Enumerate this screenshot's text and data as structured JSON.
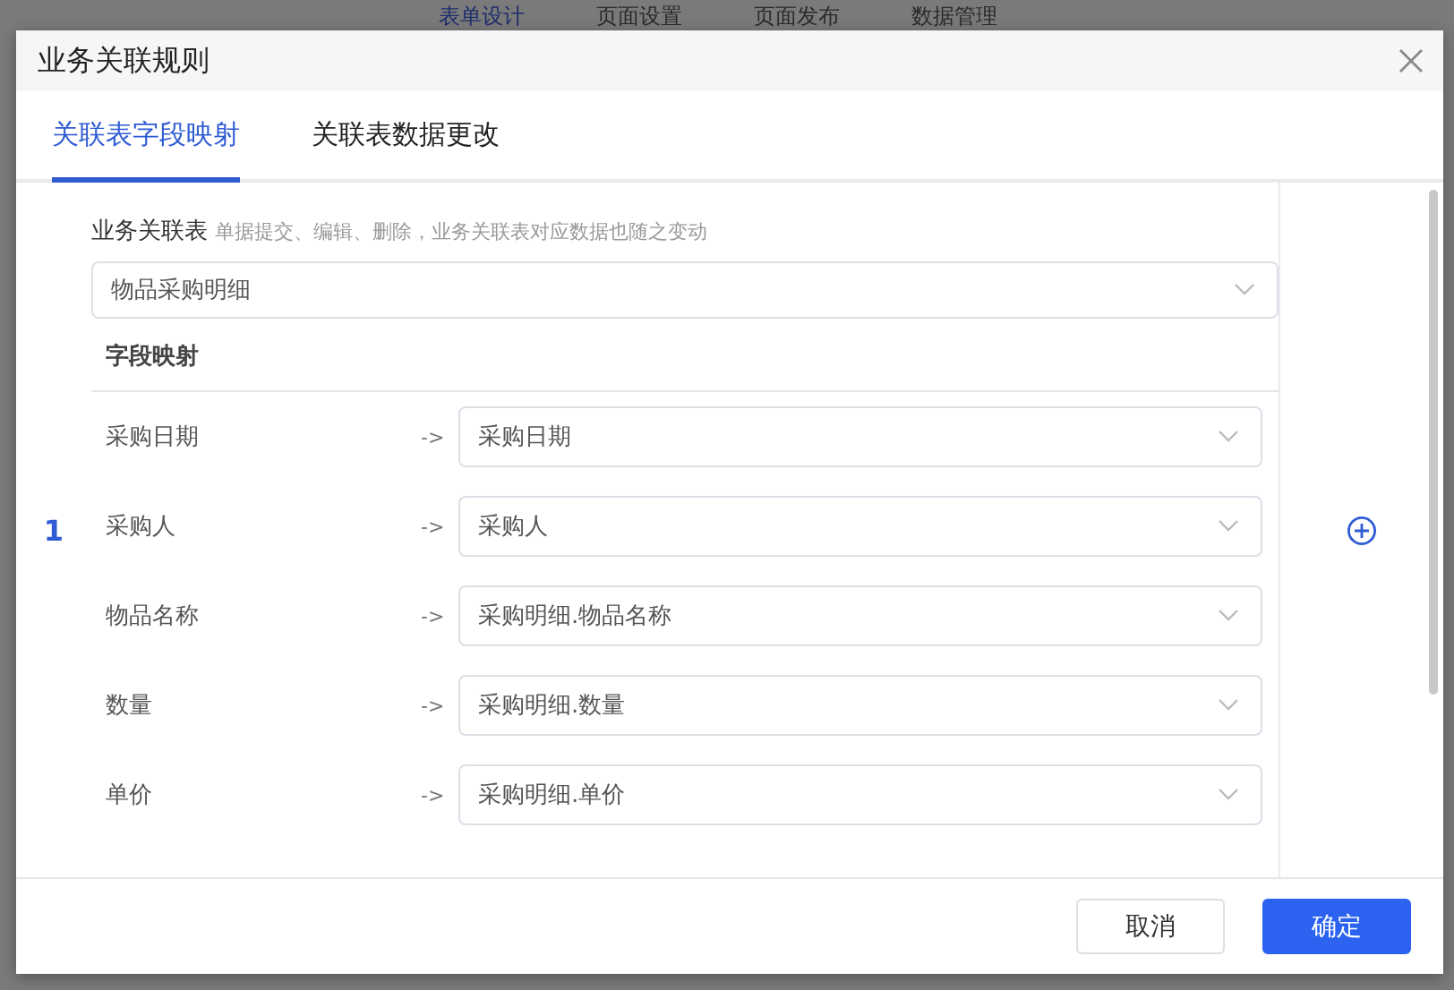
{
  "background_tabs": [
    {
      "label": "表单设计",
      "selected": true
    },
    {
      "label": "页面设置",
      "selected": false
    },
    {
      "label": "页面发布",
      "selected": false
    },
    {
      "label": "数据管理",
      "selected": false
    }
  ],
  "dialog": {
    "title": "业务关联规则",
    "tabs": [
      {
        "label": "关联表字段映射",
        "selected": true
      },
      {
        "label": "关联表数据更改",
        "selected": false
      }
    ],
    "rule_number": "1",
    "related_table": {
      "label": "业务关联表",
      "hint": "单据提交、编辑、删除，业务关联表对应数据也随之变动",
      "value": "物品采购明细"
    },
    "mapping_title": "字段映射",
    "mappings": [
      {
        "source": "采购日期",
        "arrow": "->",
        "target": "采购日期"
      },
      {
        "source": "采购人",
        "arrow": "->",
        "target": "采购人"
      },
      {
        "source": "物品名称",
        "arrow": "->",
        "target": "采购明细.物品名称"
      },
      {
        "source": "数量",
        "arrow": "->",
        "target": "采购明细.数量"
      },
      {
        "source": "单价",
        "arrow": "->",
        "target": "采购明细.单价"
      }
    ],
    "buttons": [
      {
        "label": "取消",
        "kind": "secondary"
      },
      {
        "label": "确定",
        "kind": "primary"
      }
    ]
  }
}
